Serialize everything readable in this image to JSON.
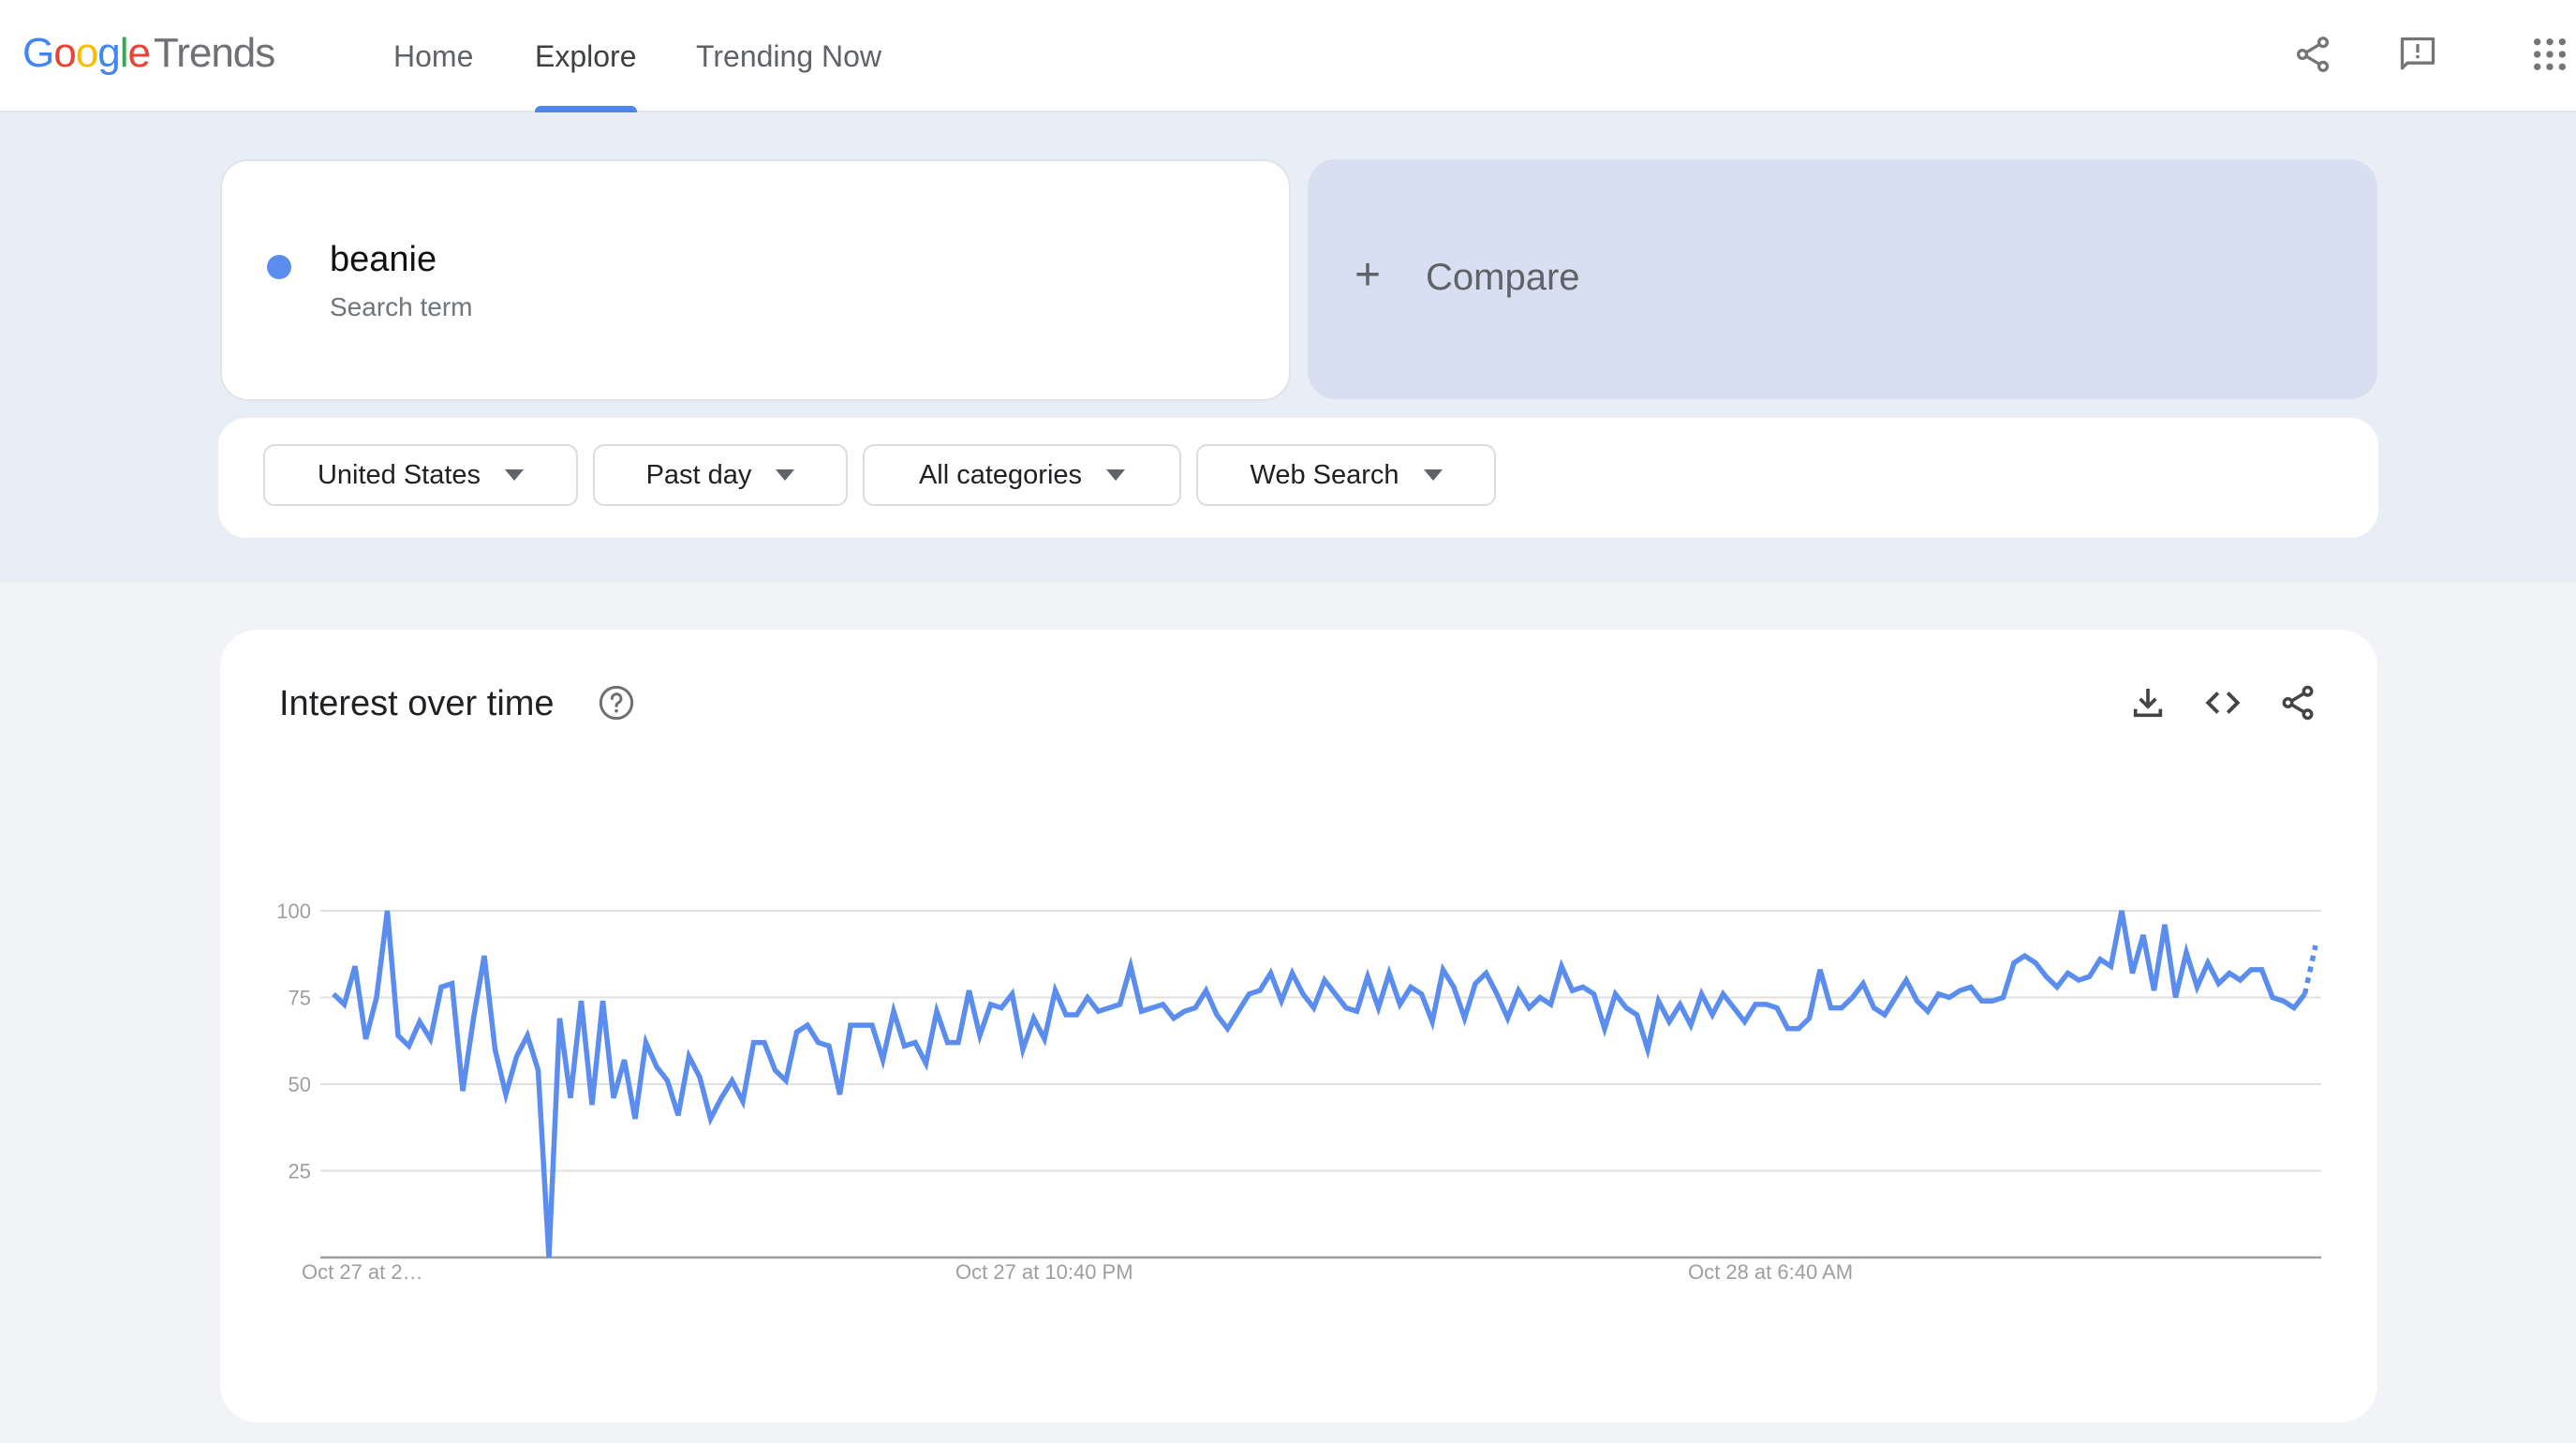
{
  "header": {
    "logo_letters": [
      "G",
      "o",
      "o",
      "g",
      "l",
      "e"
    ],
    "logo_product": "Trends",
    "nav": [
      {
        "label": "Home",
        "active": false
      },
      {
        "label": "Explore",
        "active": true
      },
      {
        "label": "Trending Now",
        "active": false
      }
    ],
    "icons": [
      "share-icon",
      "feedback-icon",
      "apps-grid-icon"
    ]
  },
  "search": {
    "term": "beanie",
    "term_type": "Search term",
    "term_color": "#5b8def",
    "compare_label": "Compare"
  },
  "filters": [
    {
      "label": "United States"
    },
    {
      "label": "Past day"
    },
    {
      "label": "All categories"
    },
    {
      "label": "Web Search"
    }
  ],
  "interest_card": {
    "title": "Interest over time",
    "actions": [
      "download-icon",
      "embed-icon",
      "share-icon"
    ]
  },
  "chart_data": {
    "type": "line",
    "title": "Interest over time",
    "xlabel": "",
    "ylabel": "",
    "ylim": [
      0,
      100
    ],
    "yticks": [
      25,
      50,
      75,
      100
    ],
    "grid": true,
    "x_tick_labels": [
      {
        "label": "Oct 27 at 2…",
        "index": 0
      },
      {
        "label": "Oct 27 at 10:40 PM",
        "index": 66
      },
      {
        "label": "Oct 28 at 6:40 AM",
        "index": 134
      }
    ],
    "series": [
      {
        "name": "beanie",
        "color": "#5b8def",
        "partial_last_point": true,
        "values": [
          76,
          73,
          84,
          63,
          75,
          100,
          64,
          61,
          68,
          63,
          78,
          79,
          48,
          69,
          87,
          60,
          47,
          58,
          64,
          54,
          0,
          69,
          46,
          74,
          44,
          74,
          46,
          57,
          40,
          62,
          55,
          51,
          41,
          58,
          52,
          40,
          46,
          51,
          45,
          62,
          62,
          54,
          51,
          65,
          67,
          62,
          61,
          47,
          67,
          67,
          67,
          57,
          71,
          61,
          62,
          56,
          71,
          62,
          62,
          77,
          64,
          73,
          72,
          76,
          60,
          69,
          63,
          77,
          70,
          70,
          75,
          71,
          72,
          73,
          84,
          71,
          72,
          73,
          69,
          71,
          72,
          77,
          70,
          66,
          71,
          76,
          77,
          82,
          74,
          82,
          76,
          72,
          80,
          76,
          72,
          71,
          81,
          72,
          82,
          73,
          78,
          76,
          68,
          83,
          78,
          69,
          79,
          82,
          76,
          69,
          77,
          72,
          75,
          73,
          84,
          77,
          78,
          76,
          66,
          76,
          72,
          70,
          60,
          74,
          68,
          73,
          67,
          76,
          70,
          76,
          72,
          68,
          73,
          73,
          72,
          66,
          66,
          69,
          83,
          72,
          72,
          75,
          79,
          72,
          70,
          75,
          80,
          74,
          71,
          76,
          75,
          77,
          78,
          74,
          74,
          75,
          85,
          87,
          85,
          81,
          78,
          82,
          80,
          81,
          86,
          84,
          100,
          82,
          93,
          77,
          96,
          75,
          88,
          78,
          85,
          79,
          82,
          80,
          83,
          83,
          75,
          74,
          72,
          76,
          90
        ]
      }
    ]
  }
}
